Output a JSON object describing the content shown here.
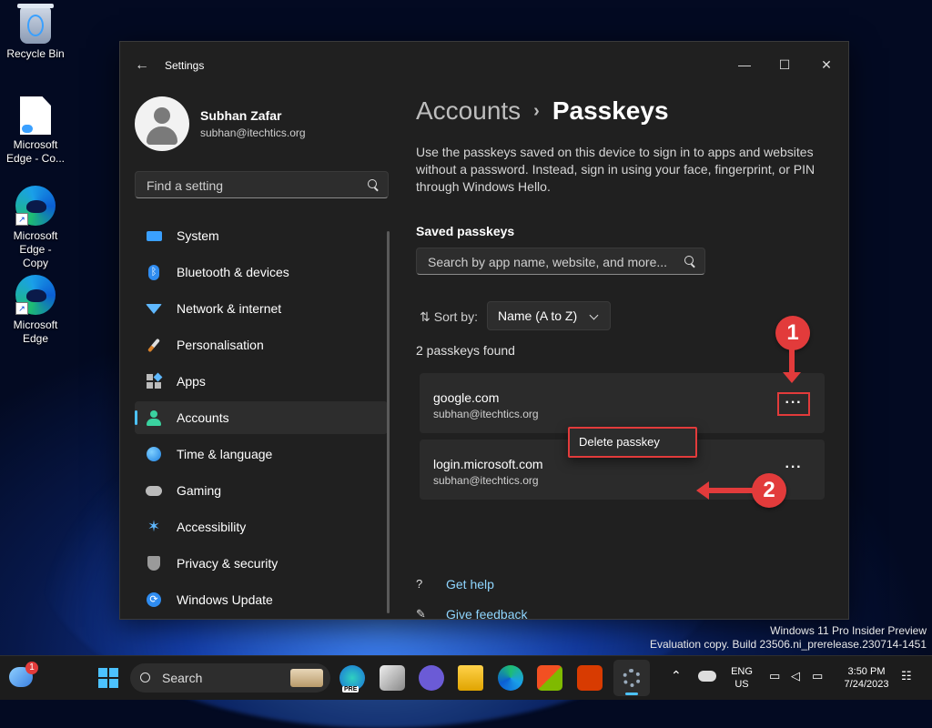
{
  "desktop": {
    "icons": [
      {
        "label": "Recycle Bin"
      },
      {
        "label": "Microsoft Edge - Co..."
      },
      {
        "label": "Microsoft Edge - Copy"
      },
      {
        "label": "Microsoft Edge"
      }
    ]
  },
  "window": {
    "title": "Settings",
    "back_glyph": "←",
    "controls": {
      "minimize": "—",
      "maximize": "☐",
      "close": "✕"
    }
  },
  "user": {
    "name": "Subhan Zafar",
    "email": "subhan@itechtics.org"
  },
  "sidebar": {
    "search_placeholder": "Find a setting",
    "items": [
      {
        "label": "System",
        "icon": "monitor-icon"
      },
      {
        "label": "Bluetooth & devices",
        "icon": "bluetooth-icon"
      },
      {
        "label": "Network & internet",
        "icon": "wifi-icon"
      },
      {
        "label": "Personalisation",
        "icon": "brush-icon"
      },
      {
        "label": "Apps",
        "icon": "apps-icon"
      },
      {
        "label": "Accounts",
        "icon": "account-icon"
      },
      {
        "label": "Time & language",
        "icon": "globe-icon"
      },
      {
        "label": "Gaming",
        "icon": "gamepad-icon"
      },
      {
        "label": "Accessibility",
        "icon": "accessibility-icon"
      },
      {
        "label": "Privacy & security",
        "icon": "shield-icon"
      },
      {
        "label": "Windows Update",
        "icon": "update-icon"
      }
    ],
    "active": "Accounts"
  },
  "content": {
    "breadcrumb_parent": "Accounts",
    "breadcrumb_sep": "›",
    "breadcrumb_current": "Passkeys",
    "description": "Use the passkeys saved on this device to sign in to apps and websites without a password. Instead, sign in using your face, fingerprint, or PIN through Windows Hello.",
    "saved_title": "Saved passkeys",
    "search_placeholder": "Search by app name, website, and more...",
    "sort_label": "Sort by:",
    "sort_value": "Name (A to Z)",
    "found_text": "2 passkeys found",
    "passkeys": [
      {
        "site": "google.com",
        "email": "subhan@itechtics.org"
      },
      {
        "site": "login.microsoft.com",
        "email": "subhan@itechtics.org"
      }
    ],
    "more_glyph": "···",
    "context_menu_item": "Delete passkey",
    "get_help": "Get help",
    "give_feedback": "Give feedback"
  },
  "annotations": {
    "step1": "1",
    "step2": "2",
    "color": "#e23b3b"
  },
  "watermark": {
    "line1": "Windows 11 Pro Insider Preview",
    "line2": "Evaluation copy. Build 23506.ni_prerelease.230714-1451"
  },
  "taskbar": {
    "search_label": "Search",
    "notification_count": "1",
    "language_line1": "ENG",
    "language_line2": "US",
    "time": "3:50 PM",
    "date": "7/24/2023",
    "pre_badge": "PRE"
  },
  "colors": {
    "accent": "#4cc2ff",
    "link": "#8fd6ff",
    "window_bg": "#202020",
    "card_bg": "#2b2b2b"
  }
}
